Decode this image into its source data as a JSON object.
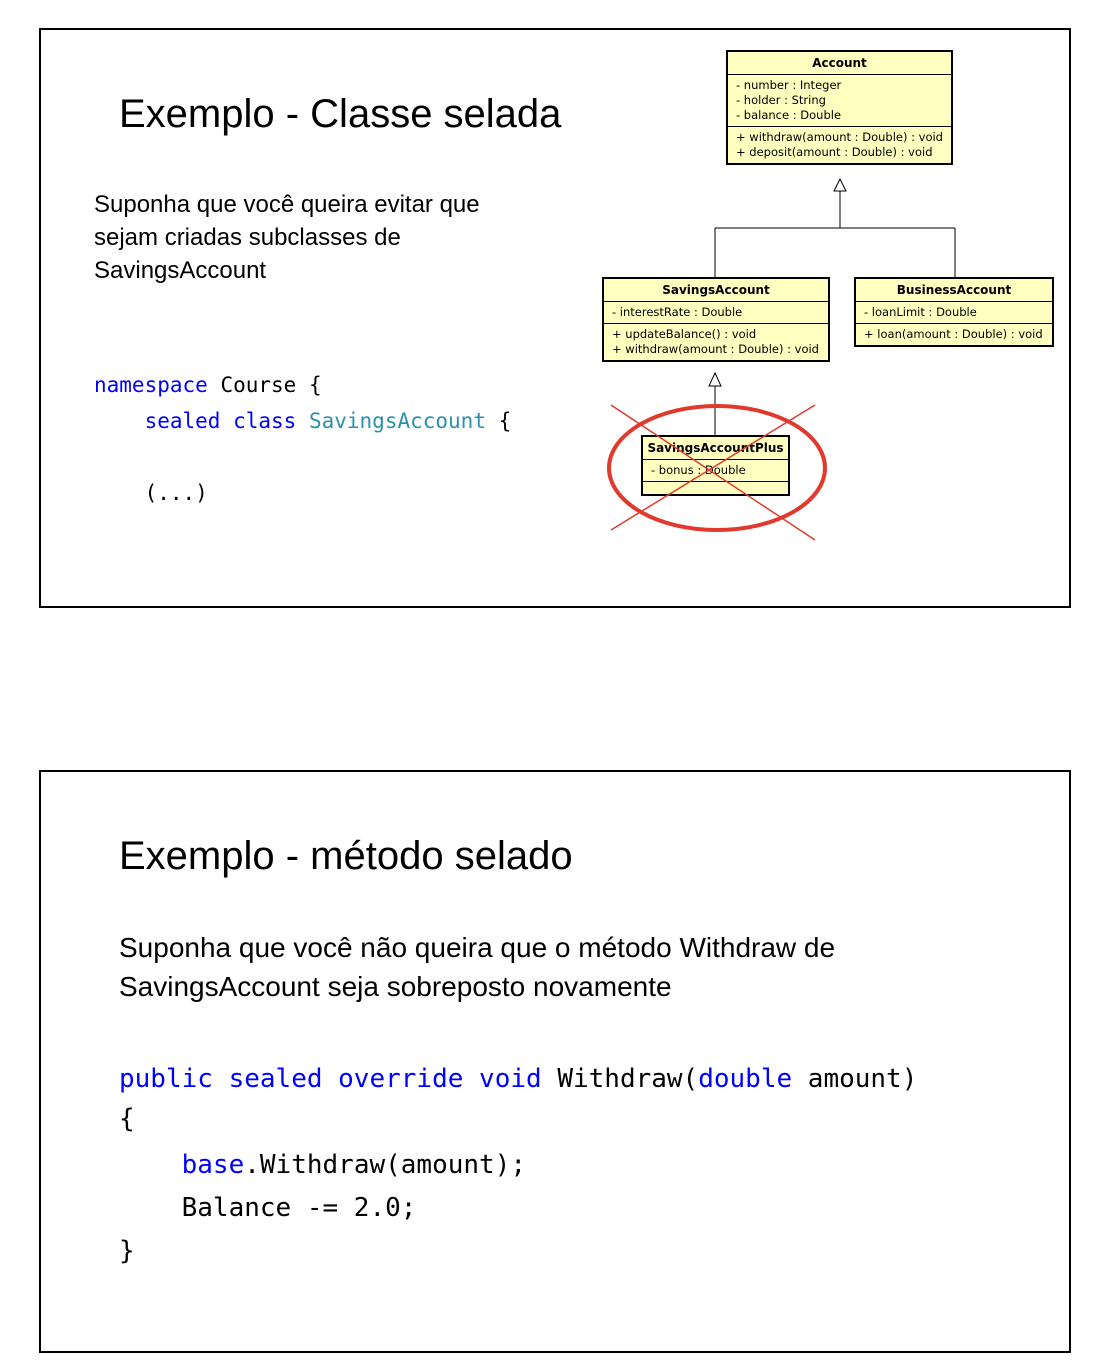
{
  "slide1": {
    "title": "Exemplo - Classe selada",
    "paragraph_lines": [
      "Suponha que você queira evitar que",
      "sejam criadas subclasses de",
      "SavingsAccount"
    ],
    "code": {
      "line1": {
        "kw": "namespace",
        "rest": " Course {"
      },
      "line2": {
        "kw1": "sealed",
        "kw2": "class",
        "type": "SavingsAccount",
        "rest": " {"
      },
      "line3": "(...)"
    },
    "uml": {
      "account": {
        "name": "Account",
        "attributes": [
          "- number : Integer",
          "- holder : String",
          "- balance : Double"
        ],
        "methods": [
          "+ withdraw(amount : Double) : void",
          "+ deposit(amount : Double) : void"
        ]
      },
      "savings": {
        "name": "SavingsAccount",
        "attributes": [
          "- interestRate : Double"
        ],
        "methods": [
          "+ updateBalance() : void",
          "+ withdraw(amount : Double) : void"
        ]
      },
      "business": {
        "name": "BusinessAccount",
        "attributes": [
          "- loanLimit : Double"
        ],
        "methods": [
          "+ loan(amount : Double) : void"
        ]
      },
      "savings_plus": {
        "name": "SavingsAccountPlus",
        "attributes": [
          "- bonus : Double"
        ]
      },
      "strike_color": "#e03a2e"
    }
  },
  "slide2": {
    "title": "Exemplo - método selado",
    "paragraph_lines": [
      "Suponha que você não queira que o método Withdraw de",
      "SavingsAccount seja sobreposto novamente"
    ],
    "code": {
      "line1": {
        "kw1": "public",
        "kw2": "sealed",
        "kw3": "override",
        "kw4": "void",
        "name": "Withdraw(",
        "kw5": "double",
        "rest": " amount)"
      },
      "line2": "{",
      "line3": {
        "kw": "base",
        "rest": ".Withdraw(amount);"
      },
      "line4": "Balance -= 2.0;",
      "line5": "}"
    }
  }
}
